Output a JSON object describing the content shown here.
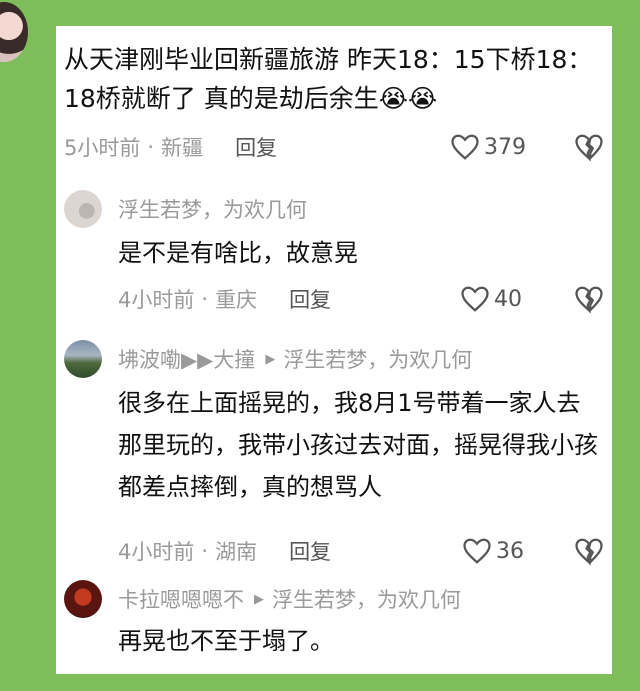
{
  "main_comment": {
    "text": "从天津刚毕业回新疆旅游 昨天18：15下桥18：18桥就断了 真的是劫后余生😭😭",
    "time": "5小时前",
    "location": "新疆",
    "reply_label": "回复",
    "likes": "379"
  },
  "replies": [
    {
      "author": "浮生若梦，为欢几何",
      "reply_to": "",
      "text": "是不是有啥比，故意晃",
      "time": "4小时前",
      "location": "重庆",
      "reply_label": "回复",
      "likes": "40"
    },
    {
      "author": "坲波嘞▶▶大撞",
      "reply_to": "浮生若梦，为欢几何",
      "text": "很多在上面摇晃的，我8月1号带着一家人去那里玩的，我带小孩过去对面，摇晃得我小孩都差点摔倒，真的想骂人",
      "time": "4小时前",
      "location": "湖南",
      "reply_label": "回复",
      "likes": "36"
    },
    {
      "author": "卡拉嗯嗯嗯不",
      "reply_to": "浮生若梦，为欢几何",
      "text": "再晃也不至于塌了。"
    }
  ],
  "separator": "·",
  "icons": {
    "like": "heart-outline-icon",
    "dislike": "broken-heart-icon",
    "reply_arrow": "triangle-right-icon"
  },
  "colors": {
    "background": "#7dbd5a",
    "card": "#ffffff",
    "meta_text": "#9a9a9a",
    "body_text": "#111111"
  }
}
